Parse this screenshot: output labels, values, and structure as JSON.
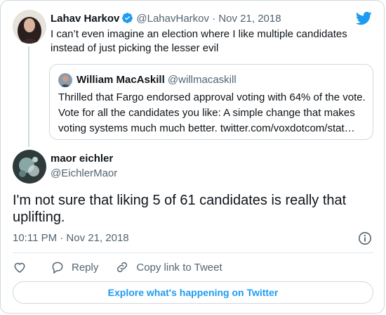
{
  "tweet_parent": {
    "author_name": "Lahav Harkov",
    "author_handle": "@LahavHarkov",
    "date": "· Nov 21, 2018",
    "text": "I can’t even imagine an election where I like multiple candidates instead of just picking the lesser evil",
    "avatar_icon": "avatar-photo",
    "verified_icon": "verified-badge-icon"
  },
  "quoted_tweet": {
    "author_name": "William MacAskill",
    "author_handle": "@willmacaskill",
    "text": "Thrilled that Fargo endorsed approval voting with 64% of the vote. Vote for all the candidates you like: A simple change that makes voting systems much much better. twitter.com/voxdotcom/stat…"
  },
  "tweet_main": {
    "author_name": "maor eichler",
    "author_handle": "@EichlerMaor",
    "text": "I'm not sure that liking 5 of 61 candidates is really that uplifting.",
    "timestamp": "10:11 PM · Nov 21, 2018"
  },
  "actions": {
    "reply_label": "Reply",
    "copy_link_label": "Copy link to Tweet"
  },
  "footer": {
    "explore_label": "Explore what's happening on Twitter"
  },
  "colors": {
    "accent": "#1d9bf0",
    "text": "#0f1419",
    "secondary": "#536471",
    "border": "#cfd9de"
  }
}
